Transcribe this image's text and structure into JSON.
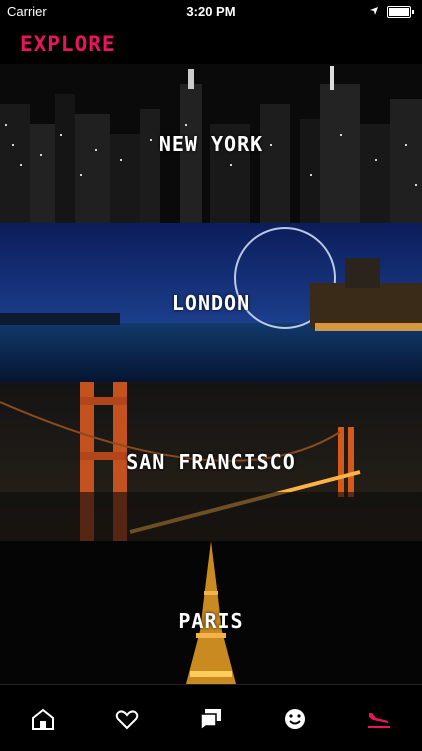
{
  "status_bar": {
    "carrier": "Carrier",
    "time": "3:20 PM"
  },
  "header": {
    "title": "EXPLORE"
  },
  "cities": [
    {
      "name": "NEW YORK"
    },
    {
      "name": "LONDON"
    },
    {
      "name": "SAN FRANCISCO"
    },
    {
      "name": "PARIS"
    }
  ],
  "tabbar": {
    "tabs": [
      {
        "icon": "home-icon"
      },
      {
        "icon": "heart-icon"
      },
      {
        "icon": "chat-icon"
      },
      {
        "icon": "smiley-icon"
      },
      {
        "icon": "plane-arrival-icon",
        "active": true
      }
    ]
  },
  "colors": {
    "accent": "#e8145e",
    "background": "#000000"
  }
}
